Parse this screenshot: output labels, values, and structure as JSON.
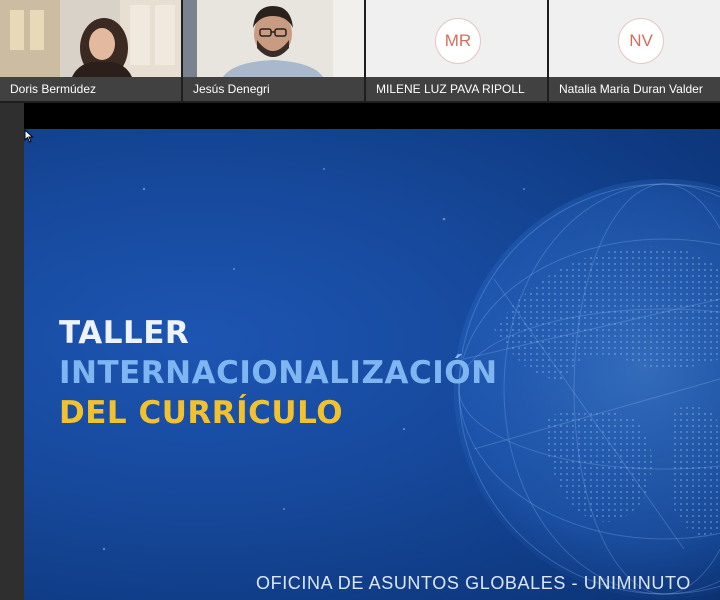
{
  "participants": [
    {
      "name": "Doris Bermúdez",
      "initials": "",
      "video": true
    },
    {
      "name": "Jesús Denegri",
      "initials": "",
      "video": true
    },
    {
      "name": "MILENE LUZ PAVA RIPOLL",
      "initials": "MR",
      "video": false
    },
    {
      "name": "Natalia Maria Duran Valder",
      "initials": "NV",
      "video": false
    }
  ],
  "slide": {
    "title_line1": "TALLER",
    "title_line2": "INTERNACIONALIZACIÓN",
    "title_line3": "DEL CURRÍCULO",
    "footer": "OFICINA DE ASUNTOS GLOBALES - UNIMINUTO"
  },
  "colors": {
    "slide_bg": "#174a9e",
    "title_white": "#eef3fb",
    "title_blue": "#7fb6f2",
    "title_yellow": "#f2c12e",
    "avatar_text": "#d56e5b"
  },
  "icons": {
    "cursor": "mouse-pointer-icon",
    "globe": "globe-graphic"
  }
}
